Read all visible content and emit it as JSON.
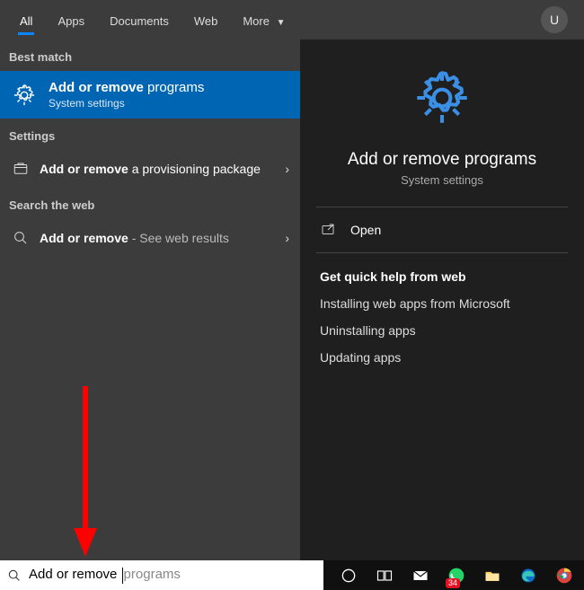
{
  "tabs": {
    "all": "All",
    "apps": "Apps",
    "documents": "Documents",
    "web": "Web",
    "more": "More"
  },
  "user_initial": "U",
  "left": {
    "best_match_label": "Best match",
    "best_match": {
      "title_bold": "Add or remove",
      "title_rest": " programs",
      "subtitle": "System settings"
    },
    "settings_label": "Settings",
    "settings_item": {
      "bold": "Add or remove",
      "rest": " a provisioning package"
    },
    "web_label": "Search the web",
    "web_item": {
      "bold": "Add or remove",
      "rest": " - See web results"
    }
  },
  "preview": {
    "title": "Add or remove programs",
    "subtitle": "System settings",
    "open": "Open",
    "quick_help_title": "Get quick help from web",
    "links": {
      "install": "Installing web apps from Microsoft",
      "uninstall": "Uninstalling apps",
      "update": "Updating apps"
    }
  },
  "search": {
    "typed": "Add or remove ",
    "ghost": "programs"
  },
  "taskbar": {
    "whatsapp_badge": "34"
  }
}
